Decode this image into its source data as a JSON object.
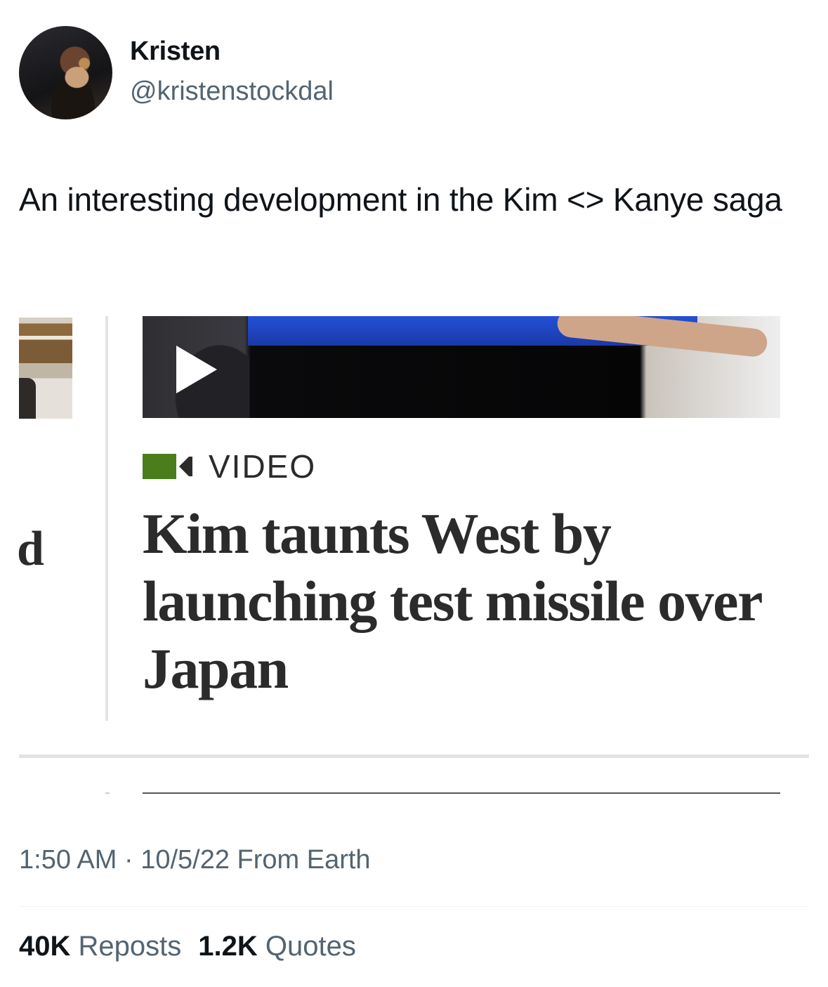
{
  "author": {
    "name": "Kristen",
    "handle": "@kristenstockdal"
  },
  "tweet": {
    "text": "An interesting development in the Kim <> Kanye saga"
  },
  "media": {
    "left_partial_letter": "d",
    "video_label": "VIDEO",
    "headline": "Kim taunts West by launching test missile over Japan"
  },
  "meta": {
    "timestamp": "1:50 AM · 10/5/22 From Earth"
  },
  "stats": {
    "reposts_count": "40K",
    "reposts_label": "Reposts",
    "quotes_count": "1.2K",
    "quotes_label": "Quotes"
  },
  "colors": {
    "text_primary": "#0f1419",
    "text_secondary": "#536471",
    "video_icon_green": "#4b7d1d",
    "headline_text": "#2b2b2b"
  }
}
